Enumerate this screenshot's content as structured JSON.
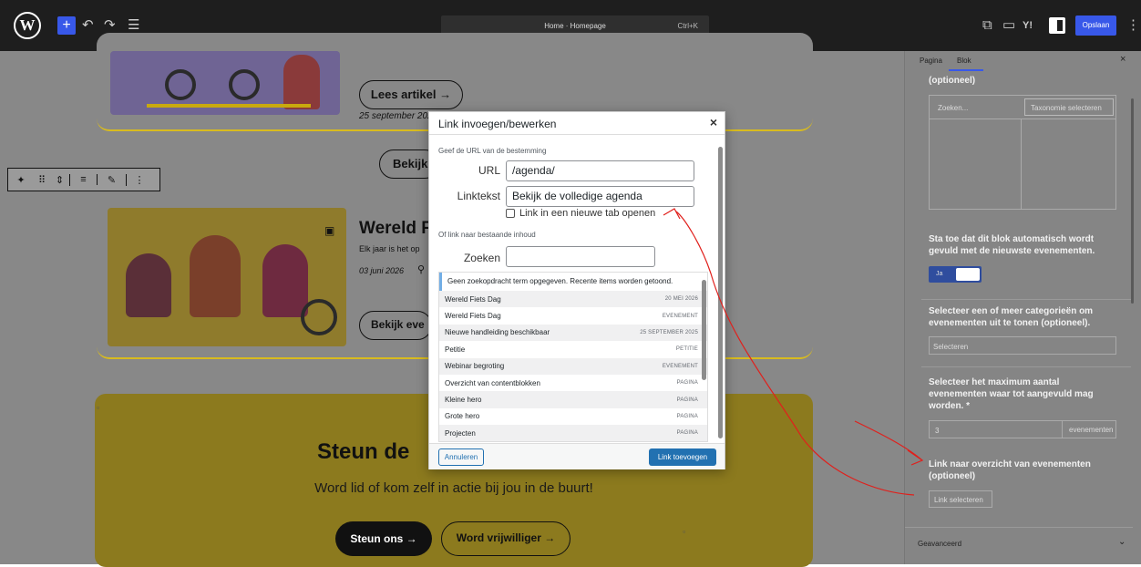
{
  "topbar": {
    "doc_title": "Home · Homepage",
    "shortcut": "Ctrl+K",
    "save_label": "Opslaan",
    "yoast_label": "Y!"
  },
  "canvas": {
    "card1": {
      "date": "25 september 2025",
      "button": "Lees artikel →"
    },
    "all_button": "Bekijk",
    "card2": {
      "title": "Wereld F",
      "excerpt": "Elk jaar is het op",
      "date": "03 juni 2026",
      "button": "Bekijk eve"
    },
    "support": {
      "title": "Steun de",
      "subtitle": "Word lid of kom zelf in actie bij jou in de buurt!",
      "btn1": "Steun ons →",
      "btn2": "Word vrijwilliger →"
    }
  },
  "sidebar": {
    "tab_page": "Pagina",
    "tab_block": "Blok",
    "optional_cut": "(optioneel)",
    "search_placeholder": "Zoeken...",
    "taxonomy_select": "Taxonomie selecteren",
    "auto_fill_text": "Sta toe dat dit blok automatisch wordt gevuld met de nieuwste evenementen.",
    "toggle_label": "Ja",
    "category_text": "Selecteer een of meer categorieën om evenementen uit te tonen (optioneel).",
    "category_placeholder": "Selecteren",
    "max_text": "Selecteer het maximum aantal evenementen waar tot aangevuld mag worden. *",
    "max_value": "3",
    "max_unit": "evenementen",
    "link_text": "Link naar overzicht van evenementen (optioneel)",
    "link_button": "Link selecteren",
    "advanced": "Geavanceerd"
  },
  "modal": {
    "title": "Link invoegen/bewerken",
    "url_hint": "Geef de URL van de bestemming",
    "url_label": "URL",
    "url_value": "/agenda/",
    "linktext_label": "Linktekst",
    "linktext_value": "Bekijk de volledige agenda",
    "newtab_label": "Link in een nieuwe tab openen",
    "existing_hint": "Of link naar bestaande inhoud",
    "search_label": "Zoeken",
    "notice": "Geen zoekopdracht term opgegeven. Recente items worden getoond.",
    "results": [
      {
        "title": "Wereld Fiets Dag",
        "info": "20 MEI 2026"
      },
      {
        "title": "Wereld Fiets Dag",
        "info": "EVENEMENT"
      },
      {
        "title": "Nieuwe handleiding beschikbaar",
        "info": "25 SEPTEMBER 2025"
      },
      {
        "title": "Petitie",
        "info": "PETITIE"
      },
      {
        "title": "Webinar begroting",
        "info": "EVENEMENT"
      },
      {
        "title": "Overzicht van contentblokken",
        "info": "PAGINA"
      },
      {
        "title": "Kleine hero",
        "info": "PAGINA"
      },
      {
        "title": "Grote hero",
        "info": "PAGINA"
      },
      {
        "title": "Projecten",
        "info": "PAGINA"
      }
    ],
    "cancel": "Annuleren",
    "submit": "Link toevoegen"
  },
  "colors": {
    "wp_blue": "#3858e9",
    "modal_blue": "#2271b1",
    "annotation_red": "#e0201c",
    "support_yellow": "#f3c80f"
  }
}
